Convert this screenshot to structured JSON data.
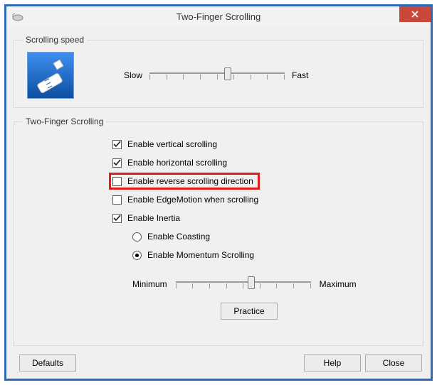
{
  "window": {
    "title": "Two-Finger Scrolling"
  },
  "scrolling_speed": {
    "legend": "Scrolling speed",
    "slow": "Slow",
    "fast": "Fast",
    "value_pct": 58
  },
  "two_finger": {
    "legend": "Two-Finger Scrolling",
    "vertical": {
      "label": "Enable vertical scrolling",
      "checked": true
    },
    "horizontal": {
      "label": "Enable horizontal scrolling",
      "checked": true
    },
    "reverse": {
      "label": "Enable reverse scrolling direction",
      "checked": false,
      "highlighted": true
    },
    "edgemotion": {
      "label": "Enable EdgeMotion when scrolling",
      "checked": false
    },
    "inertia": {
      "label": "Enable Inertia",
      "checked": true
    },
    "coasting": {
      "label": "Enable Coasting",
      "selected": false
    },
    "momentum": {
      "label": "Enable Momentum Scrolling",
      "selected": true
    },
    "inertia_slider": {
      "min_label": "Minimum",
      "max_label": "Maximum",
      "value_pct": 56
    },
    "practice": "Practice"
  },
  "buttons": {
    "defaults": "Defaults",
    "help": "Help",
    "close": "Close"
  }
}
